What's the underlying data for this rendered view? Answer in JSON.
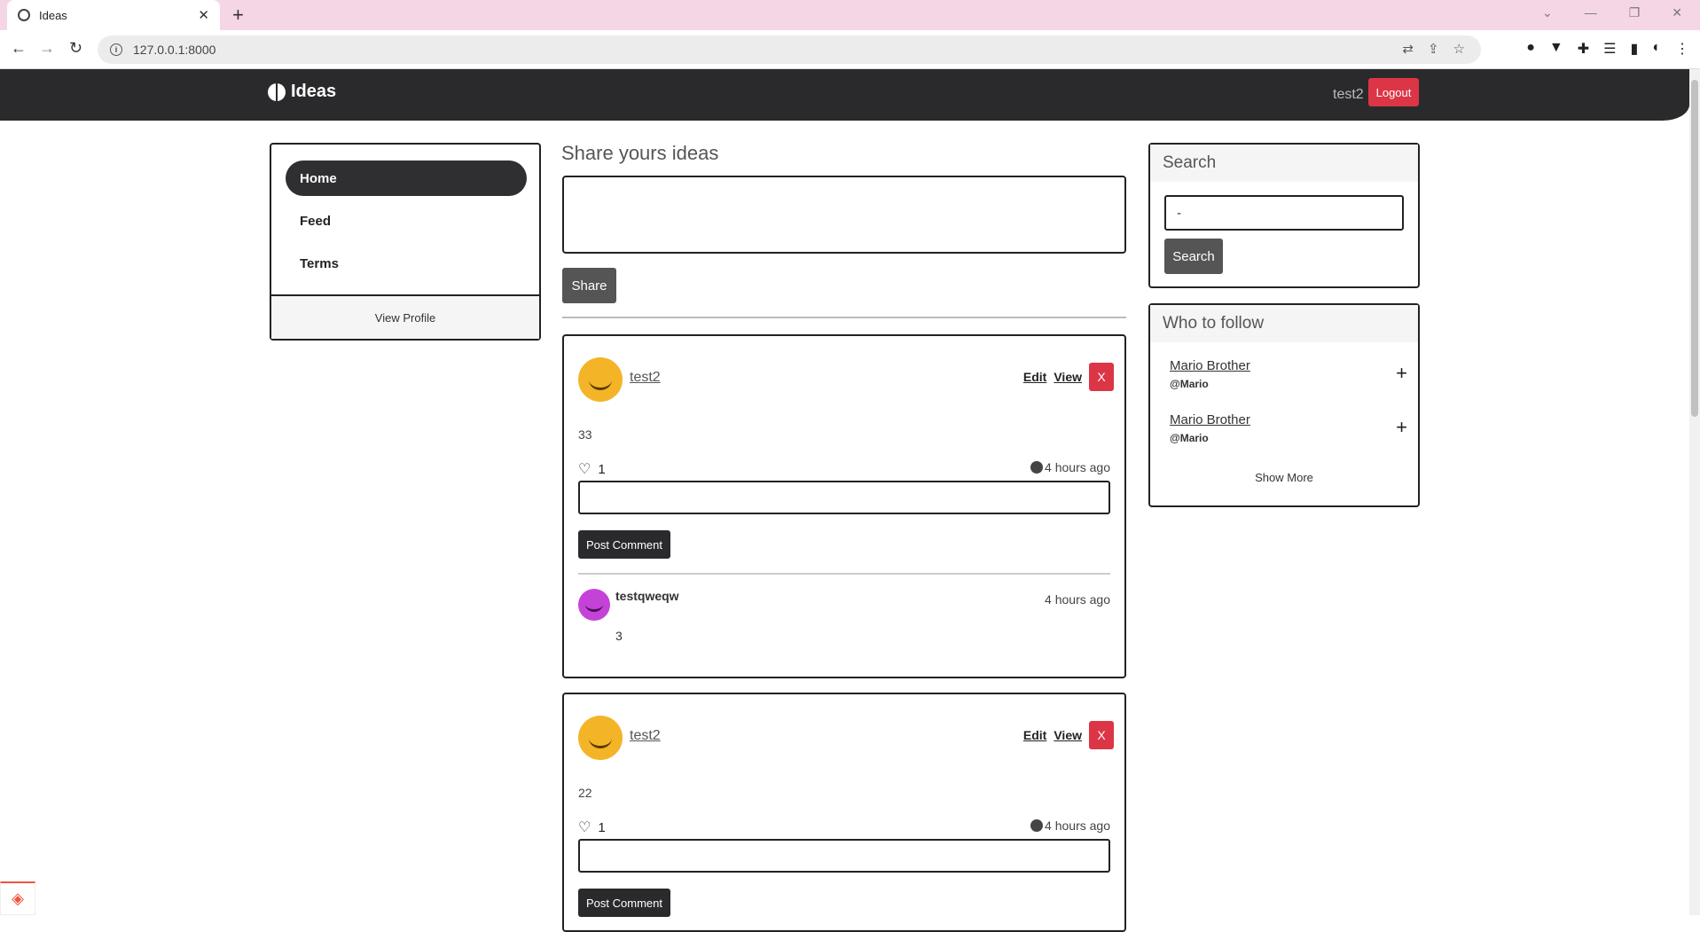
{
  "browser": {
    "tab_title": "Ideas",
    "url": "127.0.0.1:8000"
  },
  "navbar": {
    "brand": "Ideas",
    "username": "test2",
    "logout_label": "Logout"
  },
  "sidebar": {
    "links": [
      {
        "label": "Home",
        "active": true
      },
      {
        "label": "Feed",
        "active": false
      },
      {
        "label": "Terms",
        "active": false
      }
    ],
    "view_profile": "View Profile"
  },
  "share": {
    "title": "Share yours ideas",
    "button": "Share"
  },
  "posts": [
    {
      "user": "test2",
      "edit": "Edit",
      "view": "View",
      "delete": "X",
      "content": "33",
      "likes": "1",
      "time": "4 hours ago",
      "comment_button": "Post Comment",
      "comments": [
        {
          "user": "testqweqw",
          "time": "4 hours ago",
          "text": "3"
        }
      ]
    },
    {
      "user": "test2",
      "edit": "Edit",
      "view": "View",
      "delete": "X",
      "content": "22",
      "likes": "1",
      "time": "4 hours ago",
      "comment_button": "Post Comment"
    }
  ],
  "search": {
    "title": "Search",
    "value": "-",
    "button": "Search"
  },
  "follow": {
    "title": "Who to follow",
    "people": [
      {
        "name": "Mario Brother",
        "handle": "@Mario"
      },
      {
        "name": "Mario Brother",
        "handle": "@Mario"
      }
    ],
    "show_more": "Show More"
  },
  "colors": {
    "navbar": "#2a2a2c",
    "danger": "#dc3545",
    "tabbar": "#f5d6e5"
  }
}
